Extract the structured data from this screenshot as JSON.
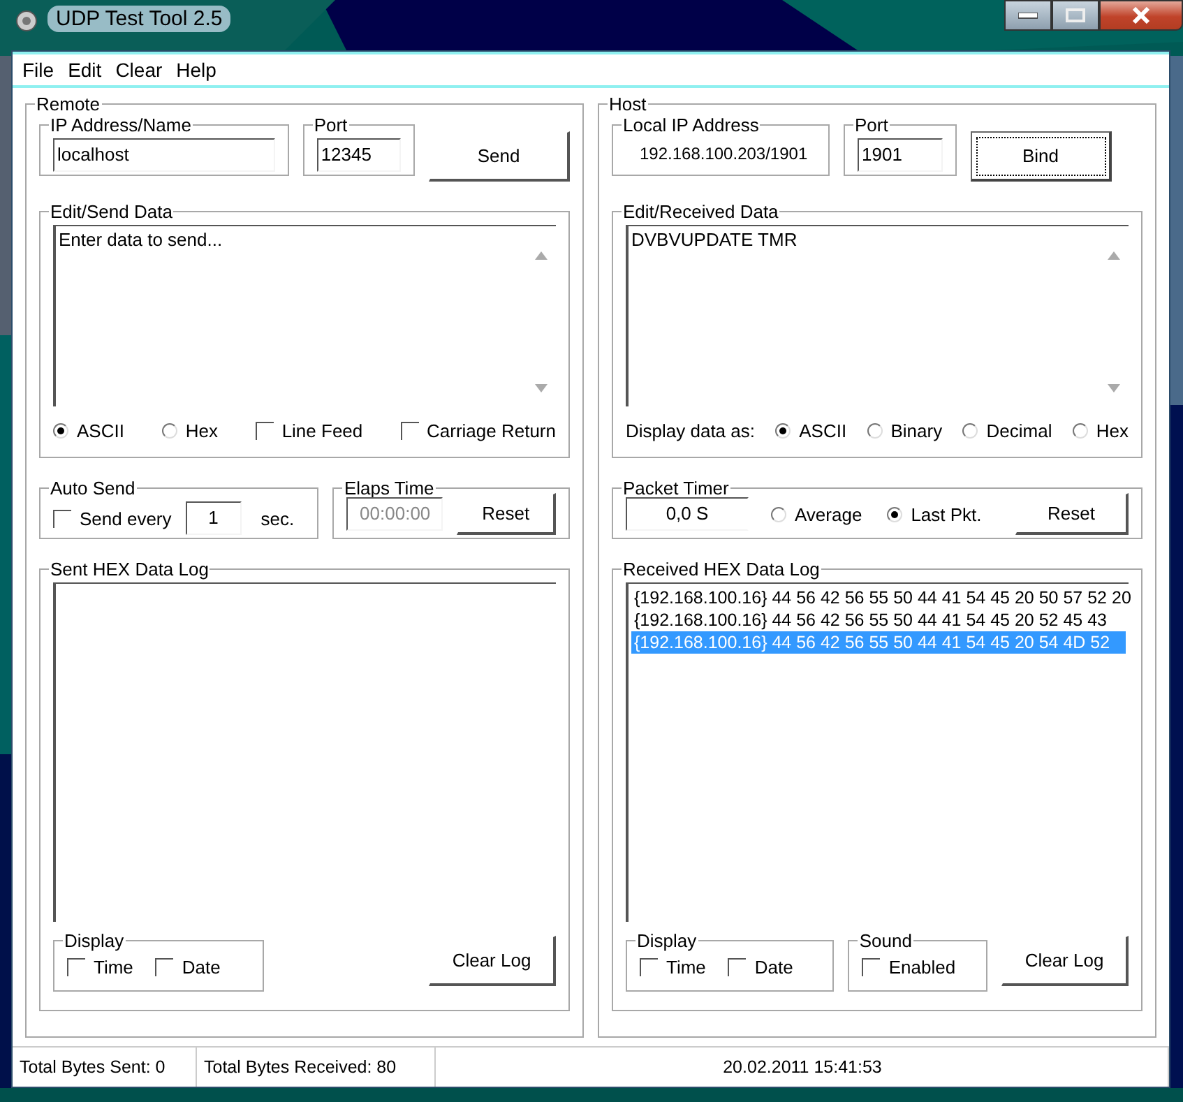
{
  "window": {
    "title": "UDP Test Tool 2.5"
  },
  "menu": [
    {
      "label": "File"
    },
    {
      "label": "Edit"
    },
    {
      "label": "Clear"
    },
    {
      "label": "Help"
    }
  ],
  "remote": {
    "title": "Remote",
    "address": {
      "label": "IP Address/Name",
      "value": "localhost"
    },
    "port": {
      "label": "Port",
      "value": "12345"
    },
    "send_button": {
      "label": "Send",
      "focused": false
    },
    "edit": {
      "title": "Edit/Send Data",
      "value": "Enter data to send..."
    },
    "options": [
      {
        "kind": "radio",
        "label": "ASCII",
        "selected": true
      },
      {
        "kind": "radio",
        "label": "Hex",
        "selected": false
      },
      {
        "kind": "checkbox",
        "label": "Line Feed",
        "checked": false
      },
      {
        "kind": "checkbox",
        "label": "Carriage Return",
        "checked": false
      }
    ],
    "auto_send": {
      "title": "Auto Send",
      "label": "Send every",
      "checked": false,
      "interval": "1",
      "unit": "sec."
    },
    "elapsed": {
      "title": "Elaps Time",
      "value": "00:00:00",
      "disabled": true,
      "reset": "Reset"
    },
    "log": {
      "title": "Sent HEX Data Log"
    },
    "display": {
      "title": "Display",
      "options": [
        {
          "label": "Time",
          "checked": false
        },
        {
          "label": "Date",
          "checked": false
        }
      ]
    },
    "clear_button": "Clear Log"
  },
  "host": {
    "title": "Host",
    "local_ip": {
      "label": "Local IP Address",
      "value": "192.168.100.203/1901"
    },
    "port": {
      "label": "Port",
      "value": "1901"
    },
    "bind_button": {
      "label": "Bind",
      "focused": true
    },
    "edit": {
      "title": "Edit/Received Data",
      "value": "DVBVUPDATE TMR"
    },
    "display_as": {
      "label": "Display data as:",
      "options": [
        {
          "label": "ASCII",
          "selected": true
        },
        {
          "label": "Binary",
          "selected": false
        },
        {
          "label": "Decimal",
          "selected": false
        },
        {
          "label": "Hex",
          "selected": false
        }
      ]
    },
    "packet_timer": {
      "title": "Packet Timer",
      "value": "0,0 S",
      "options": [
        {
          "label": "Average",
          "selected": false
        },
        {
          "label": "Last Pkt.",
          "selected": true
        }
      ],
      "reset": "Reset"
    },
    "log": {
      "title": "Received HEX Data Log",
      "rows": [
        {
          "text": "{192.168.100.16} 44 56 42 56 55 50 44 41 54 45 20 50 57 52 20",
          "selected": false
        },
        {
          "text": "{192.168.100.16} 44 56 42 56 55 50 44 41 54 45 20 52 45 43",
          "selected": false
        },
        {
          "text": "{192.168.100.16} 44 56 42 56 55 50 44 41 54 45 20 54 4D 52",
          "selected": true
        }
      ]
    },
    "display": {
      "title": "Display",
      "options": [
        {
          "label": "Time",
          "checked": false
        },
        {
          "label": "Date",
          "checked": false
        }
      ]
    },
    "sound": {
      "title": "Sound",
      "label": "Enabled",
      "checked": false
    },
    "clear_button": "Clear Log"
  },
  "status_bar": [
    {
      "text": "Total Bytes Sent: 0"
    },
    {
      "text": "Total Bytes Received: 80"
    },
    {
      "text": "20.02.2011 15:41:53"
    }
  ]
}
